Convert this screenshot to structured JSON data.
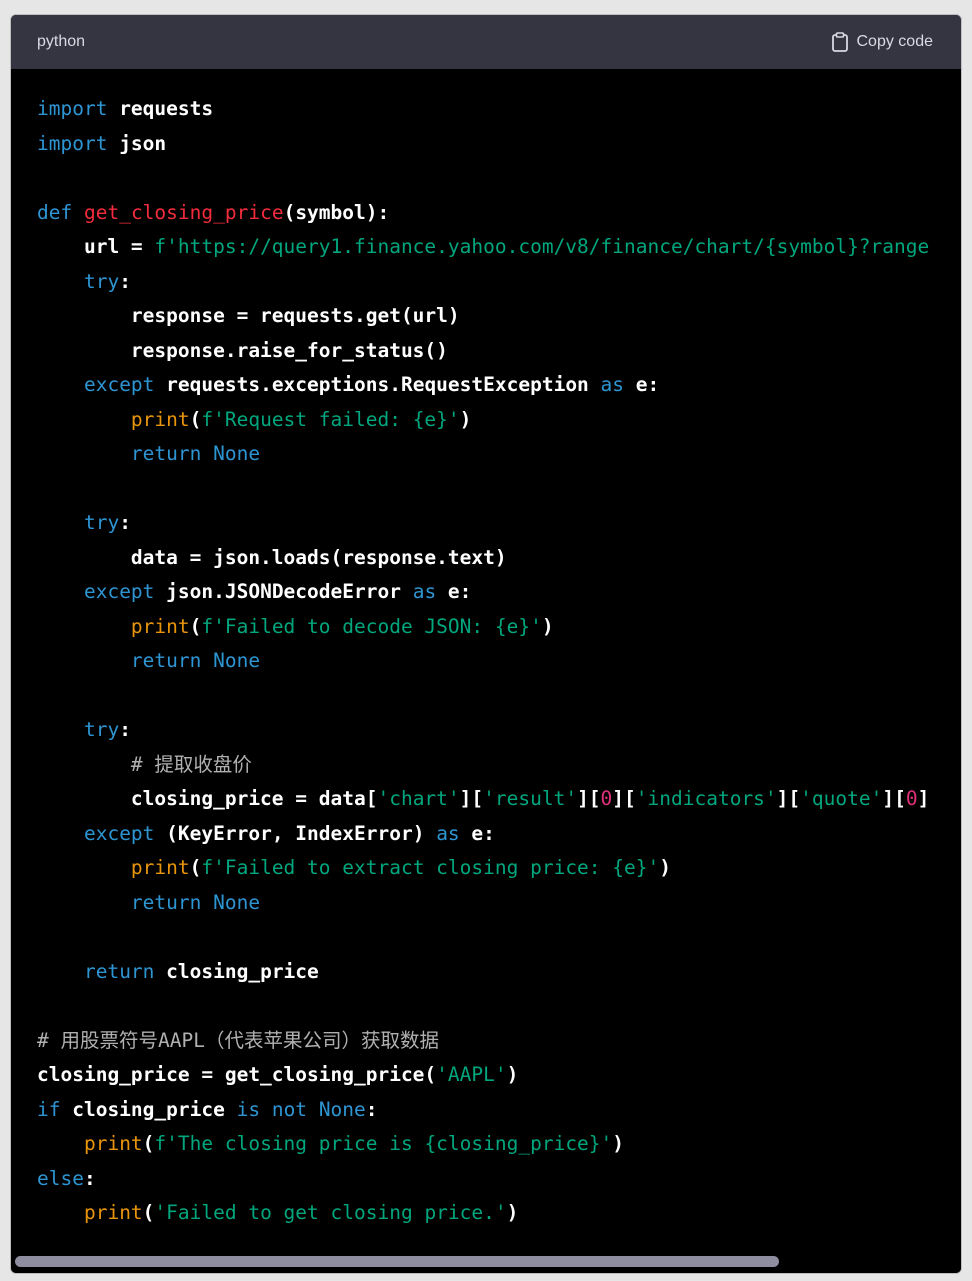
{
  "header": {
    "language": "python",
    "copy_label": "Copy code"
  },
  "colors": {
    "keyword": "#2e95d3",
    "function_name": "#f22c3d",
    "string": "#00a67d",
    "builtin": "#e9950c",
    "number": "#df3079",
    "comment": "#b0b0b0",
    "header_bg": "#343541",
    "code_bg": "#000000"
  },
  "icons": {
    "copy": "clipboard-icon"
  },
  "code": [
    [
      [
        "k",
        "import"
      ],
      [
        "p",
        " requests"
      ]
    ],
    [
      [
        "k",
        "import"
      ],
      [
        "p",
        " json"
      ]
    ],
    [],
    [
      [
        "k",
        "def"
      ],
      [
        "p",
        " "
      ],
      [
        "f",
        "get_closing_price"
      ],
      [
        "p",
        "(symbol):"
      ]
    ],
    [
      [
        "p",
        "    url = "
      ],
      [
        "s",
        "f'https://query1.finance.yahoo.com/v8/finance/chart/{symbol}?range"
      ]
    ],
    [
      [
        "p",
        "    "
      ],
      [
        "k",
        "try"
      ],
      [
        "p",
        ":"
      ]
    ],
    [
      [
        "p",
        "        response = requests.get(url)"
      ]
    ],
    [
      [
        "p",
        "        response.raise_for_status()"
      ]
    ],
    [
      [
        "p",
        "    "
      ],
      [
        "k",
        "except"
      ],
      [
        "p",
        " requests.exceptions.RequestException "
      ],
      [
        "k",
        "as"
      ],
      [
        "p",
        " e:"
      ]
    ],
    [
      [
        "p",
        "        "
      ],
      [
        "b",
        "print"
      ],
      [
        "p",
        "("
      ],
      [
        "s",
        "f'Request failed: {e}'"
      ],
      [
        "p",
        ")"
      ]
    ],
    [
      [
        "p",
        "        "
      ],
      [
        "k",
        "return"
      ],
      [
        "p",
        " "
      ],
      [
        "k",
        "None"
      ]
    ],
    [],
    [
      [
        "p",
        "    "
      ],
      [
        "k",
        "try"
      ],
      [
        "p",
        ":"
      ]
    ],
    [
      [
        "p",
        "        data = json.loads(response.text)"
      ]
    ],
    [
      [
        "p",
        "    "
      ],
      [
        "k",
        "except"
      ],
      [
        "p",
        " json.JSONDecodeError "
      ],
      [
        "k",
        "as"
      ],
      [
        "p",
        " e:"
      ]
    ],
    [
      [
        "p",
        "        "
      ],
      [
        "b",
        "print"
      ],
      [
        "p",
        "("
      ],
      [
        "s",
        "f'Failed to decode JSON: {e}'"
      ],
      [
        "p",
        ")"
      ]
    ],
    [
      [
        "p",
        "        "
      ],
      [
        "k",
        "return"
      ],
      [
        "p",
        " "
      ],
      [
        "k",
        "None"
      ]
    ],
    [],
    [
      [
        "p",
        "    "
      ],
      [
        "k",
        "try"
      ],
      [
        "p",
        ":"
      ]
    ],
    [
      [
        "p",
        "        "
      ],
      [
        "c",
        "# 提取收盘价"
      ]
    ],
    [
      [
        "p",
        "        closing_price = data["
      ],
      [
        "s",
        "'chart'"
      ],
      [
        "p",
        "]["
      ],
      [
        "s",
        "'result'"
      ],
      [
        "p",
        "]["
      ],
      [
        "n",
        "0"
      ],
      [
        "p",
        "]["
      ],
      [
        "s",
        "'indicators'"
      ],
      [
        "p",
        "]["
      ],
      [
        "s",
        "'quote'"
      ],
      [
        "p",
        "]["
      ],
      [
        "n",
        "0"
      ],
      [
        "p",
        "]"
      ]
    ],
    [
      [
        "p",
        "    "
      ],
      [
        "k",
        "except"
      ],
      [
        "p",
        " (KeyError, IndexError) "
      ],
      [
        "k",
        "as"
      ],
      [
        "p",
        " e:"
      ]
    ],
    [
      [
        "p",
        "        "
      ],
      [
        "b",
        "print"
      ],
      [
        "p",
        "("
      ],
      [
        "s",
        "f'Failed to extract closing price: {e}'"
      ],
      [
        "p",
        ")"
      ]
    ],
    [
      [
        "p",
        "        "
      ],
      [
        "k",
        "return"
      ],
      [
        "p",
        " "
      ],
      [
        "k",
        "None"
      ]
    ],
    [],
    [
      [
        "p",
        "    "
      ],
      [
        "k",
        "return"
      ],
      [
        "p",
        " closing_price"
      ]
    ],
    [],
    [
      [
        "c",
        "# 用股票符号AAPL（代表苹果公司）获取数据"
      ]
    ],
    [
      [
        "p",
        "closing_price = get_closing_price("
      ],
      [
        "s",
        "'AAPL'"
      ],
      [
        "p",
        ")"
      ]
    ],
    [
      [
        "k",
        "if"
      ],
      [
        "p",
        " closing_price "
      ],
      [
        "k",
        "is"
      ],
      [
        "p",
        " "
      ],
      [
        "k",
        "not"
      ],
      [
        "p",
        " "
      ],
      [
        "k",
        "None"
      ],
      [
        "p",
        ":"
      ]
    ],
    [
      [
        "p",
        "    "
      ],
      [
        "b",
        "print"
      ],
      [
        "p",
        "("
      ],
      [
        "s",
        "f'The closing price is {closing_price}'"
      ],
      [
        "p",
        ")"
      ]
    ],
    [
      [
        "k",
        "else"
      ],
      [
        "p",
        ":"
      ]
    ],
    [
      [
        "p",
        "    "
      ],
      [
        "b",
        "print"
      ],
      [
        "p",
        "("
      ],
      [
        "s",
        "'Failed to get closing price.'"
      ],
      [
        "p",
        ")"
      ]
    ]
  ]
}
